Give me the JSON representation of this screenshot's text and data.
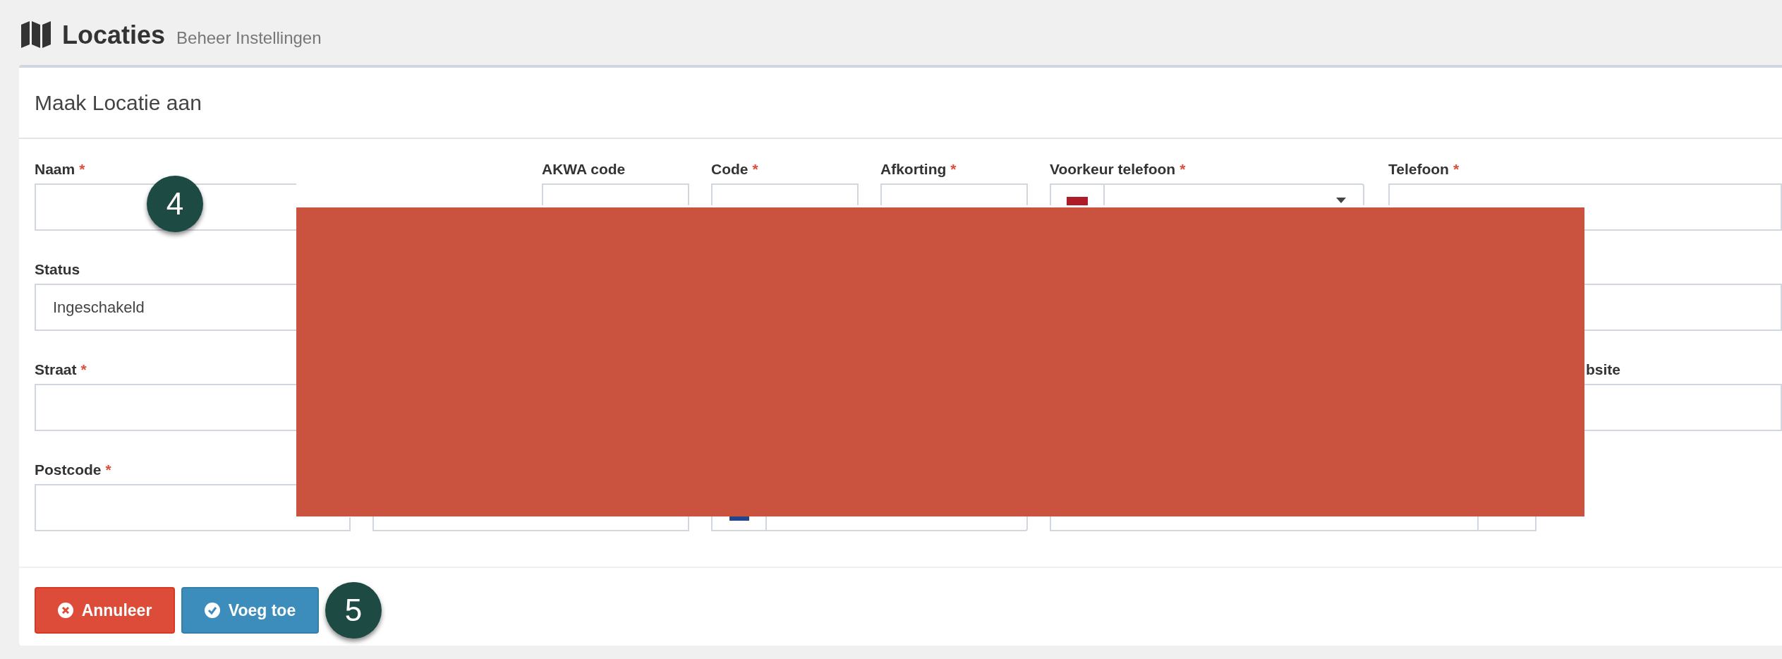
{
  "header": {
    "title": "Locaties",
    "subtitle": "Beheer Instellingen"
  },
  "card": {
    "title": "Maak Locatie aan"
  },
  "rows": [
    [
      {
        "kind": "input",
        "label": "Naam",
        "required_mark": "*"
      },
      {
        "kind": "input",
        "label": "AKWA code"
      },
      {
        "kind": "input",
        "label": "Code",
        "required_mark": "*"
      },
      {
        "kind": "input",
        "label": "Afkorting",
        "required_mark": "*"
      },
      {
        "kind": "phone-select",
        "label": "Voorkeur telefoon",
        "required_mark": "*"
      },
      {
        "kind": "input",
        "label": "Telefoon",
        "required_mark": "*"
      }
    ],
    [
      {
        "kind": "select",
        "label": "Status",
        "value": "Ingeschakeld"
      },
      {
        "kind": "input"
      }
    ],
    [
      {
        "kind": "input",
        "label": "Straat",
        "required_mark": "*"
      },
      {
        "kind": "input",
        "label": "bsite"
      }
    ],
    [
      {
        "kind": "input",
        "label": "Postcode",
        "required_mark": "*"
      },
      {
        "kind": "input"
      },
      {
        "kind": "phone"
      },
      {
        "kind": "addon-input"
      }
    ]
  ],
  "markers": [
    {
      "label": "4"
    },
    {
      "label": "5"
    }
  ],
  "buttons": [
    {
      "label": "Annuleer",
      "kind": "cancel"
    },
    {
      "label": "Voeg toe",
      "kind": "submit"
    }
  ]
}
